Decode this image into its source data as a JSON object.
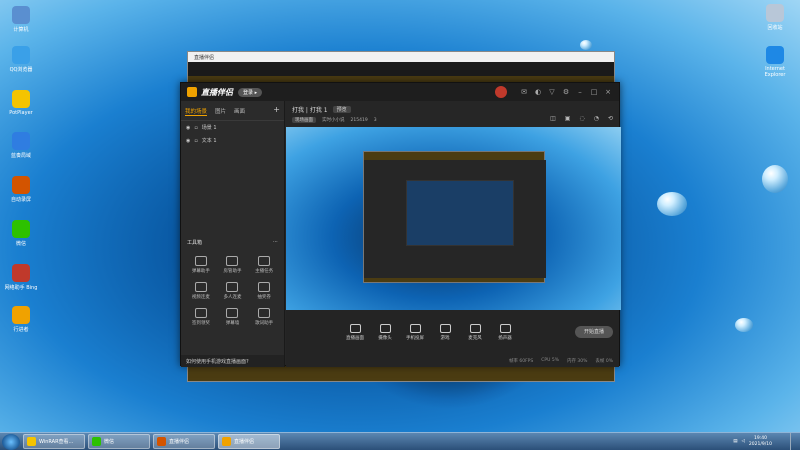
{
  "desktop": {
    "icons_left": [
      {
        "label": "计算机",
        "color": "#5a8fd0"
      },
      {
        "label": "QQ浏览器",
        "color": "#3aa0e8"
      },
      {
        "label": "PotPlayer",
        "color": "#f4c400"
      },
      {
        "label": "蓝奏局域",
        "color": "#2f7de1"
      },
      {
        "label": "自动录屏",
        "color": "#d35400"
      },
      {
        "label": "微信",
        "color": "#2dc100"
      },
      {
        "label": "网络助手 Bing",
        "color": "#c0392b"
      },
      {
        "label": "行进者",
        "color": "#f0a200"
      }
    ],
    "icons_right": [
      {
        "label": "回收站",
        "color": "#b8c7d8"
      },
      {
        "label": "Internet Explorer",
        "color": "#1e88e5"
      }
    ]
  },
  "background_window": {
    "title": "直播伴侣"
  },
  "app": {
    "brand": "直播伴侣",
    "login_label": "登录 ▸",
    "tabs": [
      "我的场景",
      "图片",
      "画面"
    ],
    "scenes": [
      "场景 1",
      "文本 1"
    ],
    "tools_title": "工具箱",
    "tools": [
      "弹幕助手",
      "房管助手",
      "主播任务",
      "视频连麦",
      "多人连麦",
      "抽奖券",
      "签到领奖",
      "弹幕墙",
      "歌词助手"
    ],
    "notice": "如何使用手机游戏直播画面?",
    "header": {
      "scene_path": "打我 | 打我 1",
      "tag": "预览",
      "info_pill": "现场画面",
      "meta": "实时小小说",
      "count": "215419",
      "likes": "3"
    },
    "bottom_tools": [
      "直播画面",
      "摄像头",
      "手机投屏",
      "游戏",
      "麦克风",
      "扬声器"
    ],
    "start_label": "开始直播",
    "status": [
      "帧率 60FPS",
      "CPU 5%",
      "内存 30%",
      "丢帧 0%"
    ]
  },
  "taskbar": {
    "tasks": [
      {
        "label": "WinRAR查看...",
        "color": "#f4c400"
      },
      {
        "label": "微信",
        "color": "#2dc100"
      },
      {
        "label": "直播伴侣",
        "color": "#d35400"
      },
      {
        "label": "直播伴侣",
        "color": "#f0a200"
      }
    ],
    "time": "19:40",
    "date": "2021/9/10"
  }
}
